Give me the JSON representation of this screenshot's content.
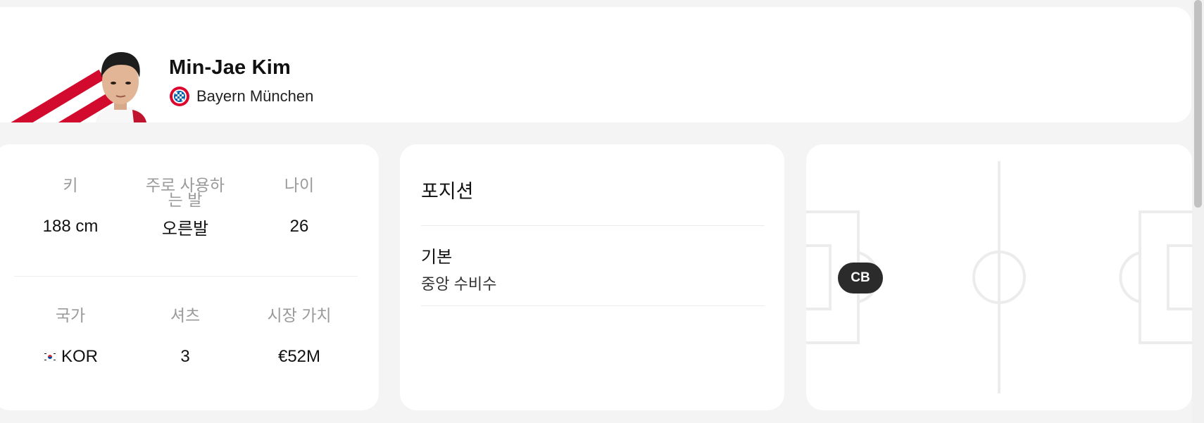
{
  "player": {
    "name": "Min-Jae Kim",
    "team": "Bayern München"
  },
  "stats": [
    {
      "label": "키",
      "value": "188 cm"
    },
    {
      "label": "주로 사용하는 발",
      "value": "오른발"
    },
    {
      "label": "나이",
      "value": "26"
    },
    {
      "label": "국가",
      "value": "KOR",
      "flag": "south-korea-flag-icon"
    },
    {
      "label": "셔츠",
      "value": "3"
    },
    {
      "label": "시장 가치",
      "value": "€52M"
    }
  ],
  "position": {
    "title": "포지션",
    "primary_label": "기본",
    "primary_value": "중앙 수비수",
    "badge": "CB"
  },
  "colors": {
    "brand_red": "#d20a2e",
    "badge_dark": "#2b2b2b",
    "label_gray": "#9a9a9a",
    "pitch_line": "#ececec"
  },
  "icons": {
    "club_logo": "bayern-munchen-logo",
    "player_photo": "player-photo"
  }
}
